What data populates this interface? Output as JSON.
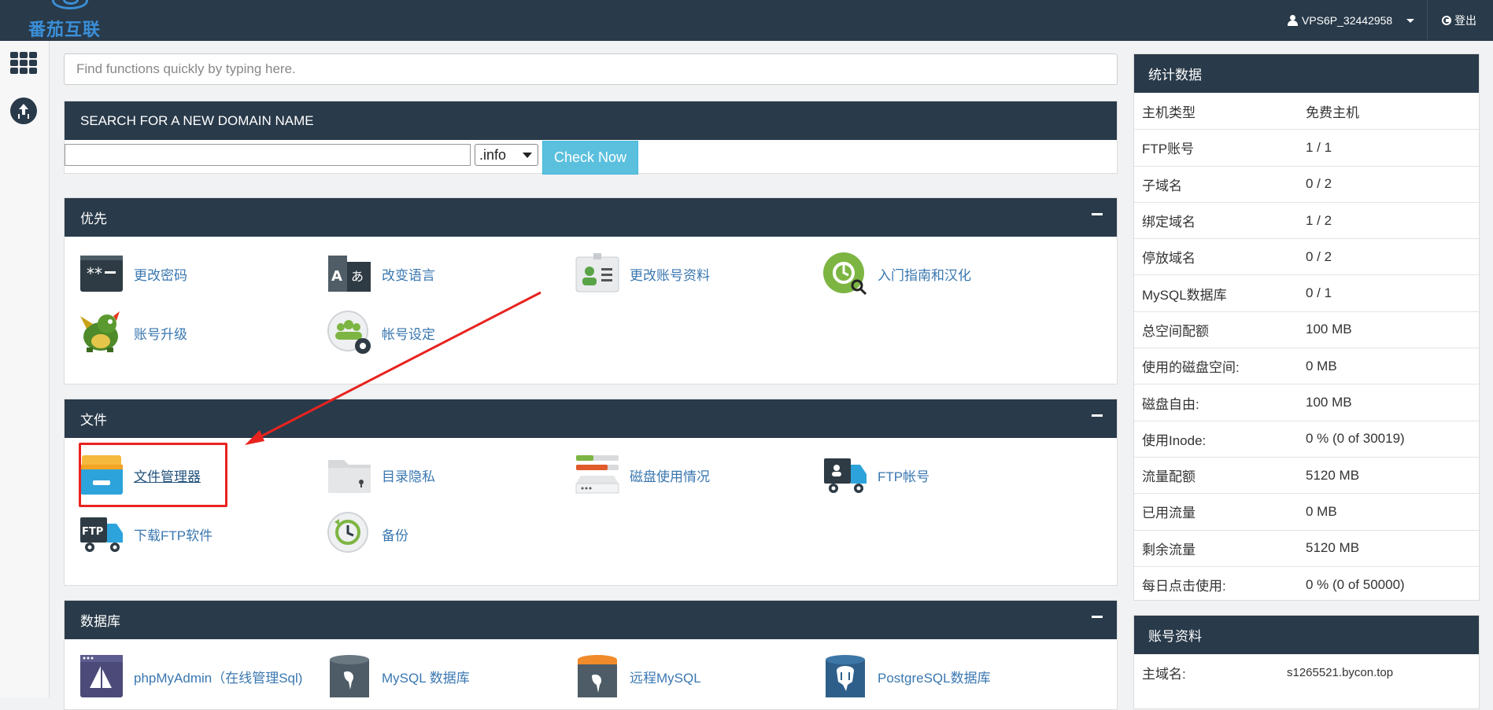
{
  "header": {
    "logo_text": "番茄互联",
    "username": "VPS6P_32442958",
    "logout_label": "登出"
  },
  "rail": {
    "apps_icon": "apps-grid-icon",
    "upload_icon": "upload-icon"
  },
  "quick_search": {
    "placeholder": "Find functions quickly by typing here."
  },
  "domain": {
    "title": "SEARCH FOR A NEW DOMAIN NAME",
    "input_value": "",
    "tld": ".info",
    "button": "Check Now"
  },
  "sections": {
    "priority": {
      "title": "优先",
      "items": [
        "更改密码",
        "改变语言",
        "更改账号资料",
        "入门指南和汉化",
        "账号升级",
        "帐号设定"
      ]
    },
    "files": {
      "title": "文件",
      "items": [
        "文件管理器",
        "目录隐私",
        "磁盘使用情况",
        "FTP帐号",
        "下载FTP软件",
        "备份"
      ]
    },
    "database": {
      "title": "数据库",
      "items": [
        "phpMyAdmin（在线管理Sql)",
        "MySQL 数据库",
        "远程MySQL",
        "PostgreSQL数据库"
      ]
    }
  },
  "stats": {
    "title": "统计数据",
    "rows": [
      {
        "k": "主机类型",
        "v": "免费主机"
      },
      {
        "k": "FTP账号",
        "v": "1 / 1"
      },
      {
        "k": "子域名",
        "v": "0 / 2"
      },
      {
        "k": "绑定域名",
        "v": "1 / 2"
      },
      {
        "k": "停放域名",
        "v": "0 / 2"
      },
      {
        "k": "MySQL数据库",
        "v": "0 / 1"
      },
      {
        "k": "总空间配额",
        "v": "100 MB"
      },
      {
        "k": "使用的磁盘空间:",
        "v": "0 MB"
      },
      {
        "k": "磁盘自由:",
        "v": "100 MB"
      },
      {
        "k": "使用Inode:",
        "v": "0 % (0 of 30019)"
      },
      {
        "k": "流量配额",
        "v": "5120 MB"
      },
      {
        "k": "已用流量",
        "v": "0 MB"
      },
      {
        "k": "剩余流量",
        "v": "5120 MB"
      },
      {
        "k": "每日点击使用:",
        "v": "0 % (0 of 50000)"
      }
    ]
  },
  "account": {
    "title": "账号资料",
    "rows": [
      {
        "k": "主域名:",
        "v": "s1265521.bycon.top"
      }
    ]
  },
  "colors": {
    "header": "#293a4a",
    "link": "#3a77b0",
    "button": "#5bc0de",
    "annotation": "#e8231f"
  }
}
